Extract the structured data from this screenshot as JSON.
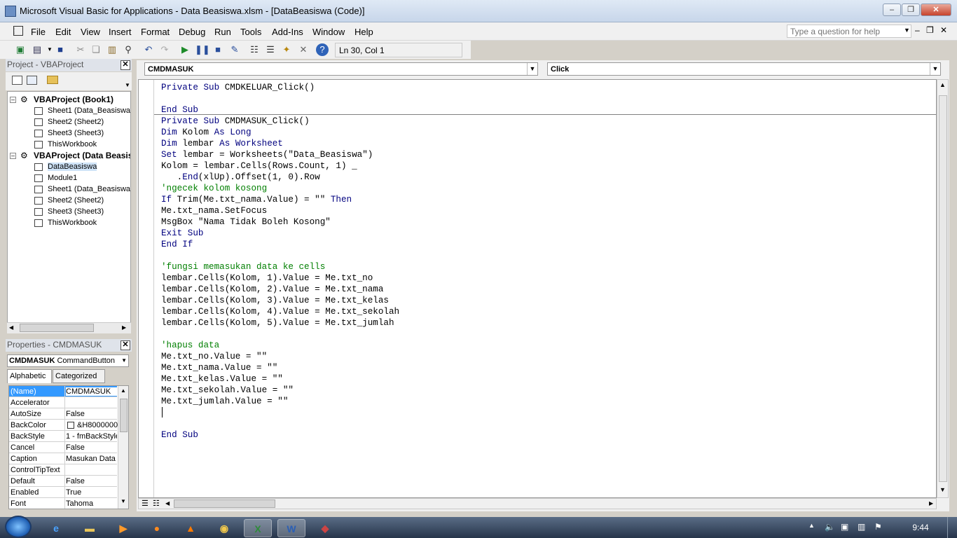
{
  "window": {
    "title": "Microsoft Visual Basic for Applications - Data Beasiswa.xlsm - [DataBeasiswa (Code)]"
  },
  "menu": [
    "File",
    "Edit",
    "View",
    "Insert",
    "Format",
    "Debug",
    "Run",
    "Tools",
    "Add-Ins",
    "Window",
    "Help"
  ],
  "help_box": {
    "placeholder": "Type a question for help"
  },
  "status": {
    "position": "Ln 30, Col 1"
  },
  "project": {
    "title": "Project - VBAProject",
    "tree": [
      {
        "label": "VBAProject (Book1)",
        "level": 0,
        "bold": true,
        "icon": "vbaproject-icon"
      },
      {
        "label": "Sheet1 (Data_Beasiswa)",
        "level": 1,
        "icon": "sheet-icon"
      },
      {
        "label": "Sheet2 (Sheet2)",
        "level": 1,
        "icon": "sheet-icon"
      },
      {
        "label": "Sheet3 (Sheet3)",
        "level": 1,
        "icon": "sheet-icon"
      },
      {
        "label": "ThisWorkbook",
        "level": 1,
        "icon": "workbook-icon"
      },
      {
        "label": "VBAProject (Data Beasis",
        "level": 0,
        "bold": true,
        "icon": "vbaproject-icon"
      },
      {
        "label": "DataBeasiswa",
        "level": 1,
        "icon": "userform-icon",
        "selected": true
      },
      {
        "label": "Module1",
        "level": 1,
        "icon": "module-icon"
      },
      {
        "label": "Sheet1 (Data_Beasiswa)",
        "level": 1,
        "icon": "sheet-icon"
      },
      {
        "label": "Sheet2 (Sheet2)",
        "level": 1,
        "icon": "sheet-icon"
      },
      {
        "label": "Sheet3 (Sheet3)",
        "level": 1,
        "icon": "sheet-icon"
      },
      {
        "label": "ThisWorkbook",
        "level": 1,
        "icon": "workbook-icon"
      }
    ]
  },
  "properties": {
    "title": "Properties - CMDMASUK",
    "object_name": "CMDMASUK",
    "object_type": "CommandButton",
    "tabs": [
      "Alphabetic",
      "Categorized"
    ],
    "rows": [
      {
        "name": "(Name)",
        "value": "CMDMASUK"
      },
      {
        "name": "Accelerator",
        "value": ""
      },
      {
        "name": "AutoSize",
        "value": "False"
      },
      {
        "name": "BackColor",
        "value": "&H8000000"
      },
      {
        "name": "BackStyle",
        "value": "1 - fmBackStyle"
      },
      {
        "name": "Cancel",
        "value": "False"
      },
      {
        "name": "Caption",
        "value": "Masukan Data"
      },
      {
        "name": "ControlTipText",
        "value": ""
      },
      {
        "name": "Default",
        "value": "False"
      },
      {
        "name": "Enabled",
        "value": "True"
      },
      {
        "name": "Font",
        "value": "Tahoma"
      }
    ]
  },
  "code": {
    "object_combo": "CMDMASUK",
    "proc_combo": "Click",
    "lines": [
      {
        "t": "Private Sub CMDKELUAR_Click()",
        "k": "kw"
      },
      {
        "t": "",
        "k": ""
      },
      {
        "t": "End Sub",
        "k": "kw"
      },
      {
        "t": "Private Sub CMDMASUK_Click()",
        "k": "kw"
      },
      {
        "t": "Dim Kolom As Long",
        "k": "kw"
      },
      {
        "t": "Dim lembar As Worksheet",
        "k": "kw"
      },
      {
        "t": "Set lembar = Worksheets(\"Data_Beasiswa\")",
        "k": "mix"
      },
      {
        "t": "Kolom = lembar.Cells(Rows.Count, 1) _",
        "k": ""
      },
      {
        "t": "   .End(xlUp).Offset(1, 0).Row",
        "k": ""
      },
      {
        "t": "'ngecek kolom kosong",
        "k": "cm"
      },
      {
        "t": "If Trim(Me.txt_nama.Value) = \"\" Then",
        "k": "mix"
      },
      {
        "t": "Me.txt_nama.SetFocus",
        "k": ""
      },
      {
        "t": "MsgBox \"Nama Tidak Boleh Kosong\"",
        "k": ""
      },
      {
        "t": "Exit Sub",
        "k": "kw"
      },
      {
        "t": "End If",
        "k": "kw"
      },
      {
        "t": "",
        "k": ""
      },
      {
        "t": "'fungsi memasukan data ke cells",
        "k": "cm"
      },
      {
        "t": "lembar.Cells(Kolom, 1).Value = Me.txt_no",
        "k": ""
      },
      {
        "t": "lembar.Cells(Kolom, 2).Value = Me.txt_nama",
        "k": ""
      },
      {
        "t": "lembar.Cells(Kolom, 3).Value = Me.txt_kelas",
        "k": ""
      },
      {
        "t": "lembar.Cells(Kolom, 4).Value = Me.txt_sekolah",
        "k": ""
      },
      {
        "t": "lembar.Cells(Kolom, 5).Value = Me.txt_jumlah",
        "k": ""
      },
      {
        "t": "",
        "k": ""
      },
      {
        "t": "'hapus data",
        "k": "cm"
      },
      {
        "t": "Me.txt_no.Value = \"\"",
        "k": ""
      },
      {
        "t": "Me.txt_nama.Value = \"\"",
        "k": ""
      },
      {
        "t": "Me.txt_kelas.Value = \"\"",
        "k": ""
      },
      {
        "t": "Me.txt_sekolah.Value = \"\"",
        "k": ""
      },
      {
        "t": "Me.txt_jumlah.Value = \"\"",
        "k": ""
      },
      {
        "t": "",
        "k": ""
      },
      {
        "t": "",
        "k": ""
      },
      {
        "t": "End Sub",
        "k": "kw"
      }
    ]
  },
  "taskbar": {
    "apps": [
      "internet-explorer-icon",
      "windows-explorer-icon",
      "media-player-icon",
      "firefox-icon",
      "vlc-icon",
      "chrome-icon",
      "excel-icon",
      "word-icon",
      "other-app-icon"
    ],
    "clock": "9:44"
  }
}
